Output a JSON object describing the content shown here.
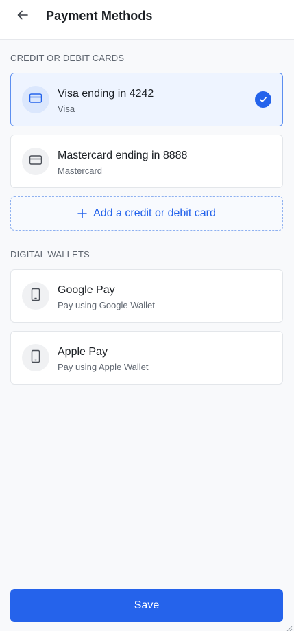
{
  "header": {
    "title": "Payment Methods",
    "back_icon": "arrow-left-icon"
  },
  "sections": {
    "cards_label": "CREDIT OR DEBIT CARDS",
    "wallets_label": "DIGITAL WALLETS"
  },
  "cards": [
    {
      "title": "Visa ending in 4242",
      "subtitle": "Visa",
      "icon": "credit-card-icon",
      "selected": true
    },
    {
      "title": "Mastercard ending in 8888",
      "subtitle": "Mastercard",
      "icon": "credit-card-icon",
      "selected": false
    }
  ],
  "add_card": {
    "label": "Add a credit or debit card",
    "icon": "plus-icon"
  },
  "wallets": [
    {
      "title": "Google Pay",
      "subtitle": "Pay using Google Wallet",
      "icon": "phone-icon"
    },
    {
      "title": "Apple Pay",
      "subtitle": "Pay using Apple Wallet",
      "icon": "phone-icon"
    }
  ],
  "footer": {
    "save_label": "Save"
  },
  "colors": {
    "accent": "#2563eb",
    "selected_bg": "#eef4ff",
    "selected_border": "#5d8ff0",
    "muted_text": "#5f6670"
  }
}
